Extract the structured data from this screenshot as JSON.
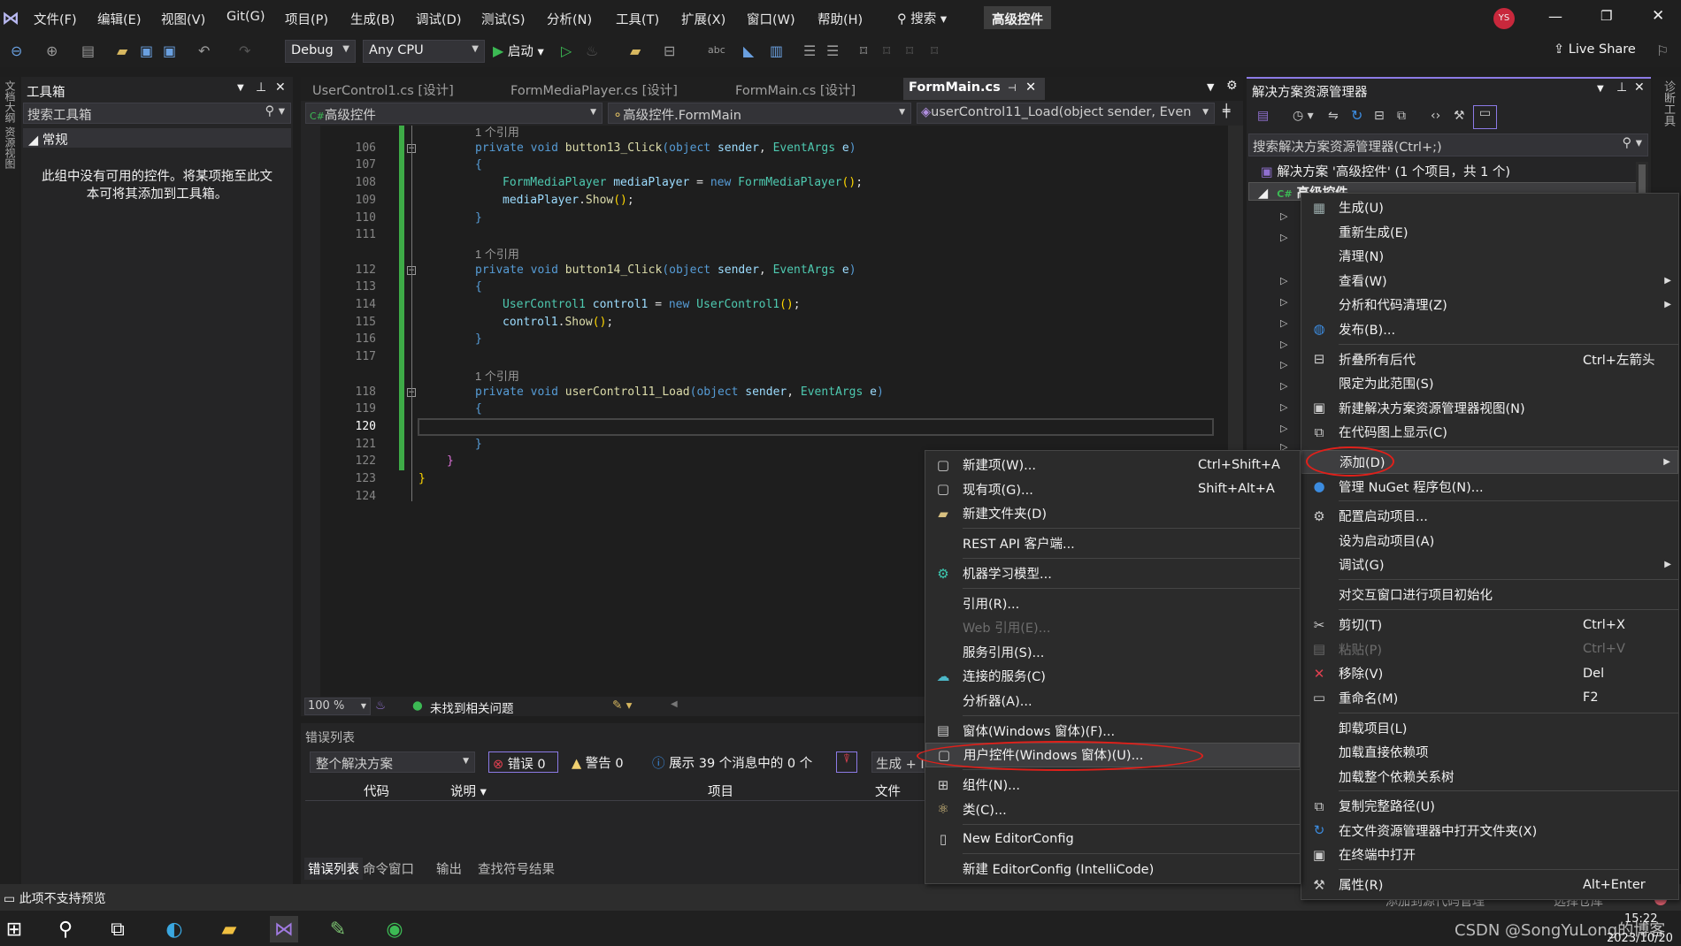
{
  "menubar": {
    "items": [
      "文件(F)",
      "编辑(E)",
      "视图(V)",
      "Git(G)",
      "项目(P)",
      "生成(B)",
      "调试(D)",
      "测试(S)",
      "分析(N)",
      "工具(T)",
      "扩展(X)",
      "窗口(W)",
      "帮助(H)"
    ],
    "search": "搜索",
    "solution_badge": "高级控件",
    "avatar": "YS"
  },
  "toolbar": {
    "config": "Debug",
    "platform": "Any CPU",
    "start": "启动",
    "live_share": "Live Share"
  },
  "toolbox": {
    "title": "工具箱",
    "search_placeholder": "搜索工具箱",
    "group": "常规",
    "empty_message_1": "此组中没有可用的控件。将某项拖至此文",
    "empty_message_2": "本可将其添加到工具箱。"
  },
  "left_strip": {
    "label": "文档大纲 资源视图"
  },
  "right_strip": {
    "label": "诊断工具"
  },
  "editor": {
    "tabs": [
      {
        "label": "UserControl1.cs [设计]",
        "active": false
      },
      {
        "label": "FormMediaPlayer.cs [设计]",
        "active": false
      },
      {
        "label": "FormMain.cs [设计]",
        "active": false
      },
      {
        "label": "FormMain.cs",
        "active": true
      }
    ],
    "nav": {
      "project": "高级控件",
      "class": "高级控件.FormMain",
      "member": "userControl11_Load(object sender, Even"
    },
    "lines": [
      {
        "lens": "1 个引用"
      },
      {
        "num": "106",
        "indent": 2,
        "tokens": [
          {
            "t": "private void ",
            "c": "kw"
          },
          {
            "t": "button13_Click",
            "c": "me"
          },
          {
            "t": "(",
            "c": "kw"
          },
          {
            "t": "object",
            "c": "kw"
          },
          {
            "t": " sender",
            "c": "id"
          },
          {
            "t": ", ",
            "c": "pl"
          },
          {
            "t": "EventArgs",
            "c": "ty"
          },
          {
            "t": " e",
            "c": "id"
          },
          {
            "t": ")",
            "c": "kw"
          }
        ]
      },
      {
        "num": "107",
        "indent": 2,
        "tokens": [
          {
            "t": "{",
            "c": "kw"
          }
        ]
      },
      {
        "num": "108",
        "indent": 3,
        "tokens": [
          {
            "t": "FormMediaPlayer",
            "c": "ty"
          },
          {
            "t": " mediaPlayer",
            "c": "id"
          },
          {
            "t": " = ",
            "c": "pl"
          },
          {
            "t": "new ",
            "c": "kw"
          },
          {
            "t": "FormMediaPlayer",
            "c": "ty"
          },
          {
            "t": "()",
            "c": "go"
          },
          {
            "t": ";",
            "c": "pl"
          }
        ]
      },
      {
        "num": "109",
        "indent": 3,
        "tokens": [
          {
            "t": "mediaPlayer",
            "c": "id"
          },
          {
            "t": ".",
            "c": "pl"
          },
          {
            "t": "Show",
            "c": "me"
          },
          {
            "t": "()",
            "c": "go"
          },
          {
            "t": ";",
            "c": "pl"
          }
        ]
      },
      {
        "num": "110",
        "indent": 2,
        "tokens": [
          {
            "t": "}",
            "c": "kw"
          }
        ]
      },
      {
        "num": "111",
        "indent": 2,
        "tokens": []
      },
      {
        "lens": "1 个引用"
      },
      {
        "num": "112",
        "indent": 2,
        "tokens": [
          {
            "t": "private void ",
            "c": "kw"
          },
          {
            "t": "button14_Click",
            "c": "me"
          },
          {
            "t": "(",
            "c": "kw"
          },
          {
            "t": "object",
            "c": "kw"
          },
          {
            "t": " sender",
            "c": "id"
          },
          {
            "t": ", ",
            "c": "pl"
          },
          {
            "t": "EventArgs",
            "c": "ty"
          },
          {
            "t": " e",
            "c": "id"
          },
          {
            "t": ")",
            "c": "kw"
          }
        ]
      },
      {
        "num": "113",
        "indent": 2,
        "tokens": [
          {
            "t": "{",
            "c": "kw"
          }
        ]
      },
      {
        "num": "114",
        "indent": 3,
        "tokens": [
          {
            "t": "UserControl1",
            "c": "ty"
          },
          {
            "t": " control1",
            "c": "id"
          },
          {
            "t": " = ",
            "c": "pl"
          },
          {
            "t": "new ",
            "c": "kw"
          },
          {
            "t": "UserControl1",
            "c": "ty"
          },
          {
            "t": "()",
            "c": "go"
          },
          {
            "t": ";",
            "c": "pl"
          }
        ]
      },
      {
        "num": "115",
        "indent": 3,
        "tokens": [
          {
            "t": "control1",
            "c": "id"
          },
          {
            "t": ".",
            "c": "pl"
          },
          {
            "t": "Show",
            "c": "me"
          },
          {
            "t": "()",
            "c": "go"
          },
          {
            "t": ";",
            "c": "pl"
          }
        ]
      },
      {
        "num": "116",
        "indent": 2,
        "tokens": [
          {
            "t": "}",
            "c": "kw"
          }
        ]
      },
      {
        "num": "117",
        "indent": 2,
        "tokens": []
      },
      {
        "lens": "1 个引用"
      },
      {
        "num": "118",
        "indent": 2,
        "tokens": [
          {
            "t": "private void ",
            "c": "kw"
          },
          {
            "t": "userControl11_Load",
            "c": "me"
          },
          {
            "t": "(",
            "c": "kw"
          },
          {
            "t": "object",
            "c": "kw"
          },
          {
            "t": " sender",
            "c": "id"
          },
          {
            "t": ", ",
            "c": "pl"
          },
          {
            "t": "EventArgs",
            "c": "ty"
          },
          {
            "t": " e",
            "c": "id"
          },
          {
            "t": ")",
            "c": "kw"
          }
        ]
      },
      {
        "num": "119",
        "indent": 2,
        "tokens": [
          {
            "t": "{",
            "c": "kw"
          }
        ]
      },
      {
        "num": "120",
        "indent": 2,
        "current": true,
        "tokens": []
      },
      {
        "num": "121",
        "indent": 2,
        "tokens": [
          {
            "t": "}",
            "c": "kw"
          }
        ]
      },
      {
        "num": "122",
        "indent": 1,
        "tokens": [
          {
            "t": "}",
            "c": "pk"
          }
        ]
      },
      {
        "num": "123",
        "indent": 0,
        "tokens": [
          {
            "t": "}",
            "c": "go"
          }
        ]
      },
      {
        "num": "124",
        "indent": 0,
        "tokens": []
      }
    ],
    "status": {
      "zoom": "100 %",
      "issues": "未找到相关问题"
    }
  },
  "error_list": {
    "title": "错误列表",
    "scope": "整个解决方案",
    "errors": "错误 0",
    "warnings": "警告 0",
    "messages": "展示 39 个消息中的 0 个",
    "build": "生成 + I",
    "columns": [
      "代码",
      "说明",
      "项目",
      "文件"
    ],
    "bottom_tabs": [
      "错误列表",
      "命令窗口",
      "输出",
      "查找符号结果"
    ]
  },
  "solution_explorer": {
    "title": "解决方案资源管理器",
    "search_placeholder": "搜索解决方案资源管理器(Ctrl+;)",
    "solution": "解决方案 '高级控件' (1 个项目，共 1 个)",
    "project": "高级控件"
  },
  "project_menu": [
    {
      "label": "生成(U)",
      "icon": "build-icon"
    },
    {
      "label": "重新生成(E)"
    },
    {
      "label": "清理(N)"
    },
    {
      "label": "查看(W)",
      "submenu": true
    },
    {
      "label": "分析和代码清理(Z)",
      "submenu": true
    },
    {
      "label": "发布(B)...",
      "icon": "publish-icon"
    },
    {
      "sep": true
    },
    {
      "label": "折叠所有后代",
      "shortcut": "Ctrl+左箭头",
      "icon": "collapse-icon"
    },
    {
      "label": "限定为此范围(S)"
    },
    {
      "label": "新建解决方案资源管理器视图(N)",
      "icon": "new-view-icon"
    },
    {
      "label": "在代码图上显示(C)",
      "icon": "code-map-icon"
    },
    {
      "sep": true
    },
    {
      "label": "添加(D)",
      "submenu": true,
      "highlighted": true
    },
    {
      "label": "管理 NuGet 程序包(N)...",
      "icon": "nuget-icon"
    },
    {
      "sep": true
    },
    {
      "label": "配置启动项目...",
      "icon": "settings-icon"
    },
    {
      "label": "设为启动项目(A)"
    },
    {
      "label": "调试(G)",
      "submenu": true
    },
    {
      "sep": true
    },
    {
      "label": "对交互窗口进行项目初始化"
    },
    {
      "sep": true
    },
    {
      "label": "剪切(T)",
      "shortcut": "Ctrl+X",
      "icon": "cut-icon"
    },
    {
      "label": "粘贴(P)",
      "shortcut": "Ctrl+V",
      "icon": "paste-icon",
      "disabled": true
    },
    {
      "label": "移除(V)",
      "shortcut": "Del",
      "icon": "remove-icon"
    },
    {
      "label": "重命名(M)",
      "shortcut": "F2",
      "icon": "rename-icon"
    },
    {
      "sep": true
    },
    {
      "label": "卸载项目(L)"
    },
    {
      "label": "加载直接依赖项"
    },
    {
      "label": "加载整个依赖关系树"
    },
    {
      "sep": true
    },
    {
      "label": "复制完整路径(U)",
      "icon": "copy-icon"
    },
    {
      "label": "在文件资源管理器中打开文件夹(X)",
      "icon": "open-folder-icon"
    },
    {
      "label": "在终端中打开",
      "icon": "terminal-icon"
    },
    {
      "sep": true
    },
    {
      "label": "属性(R)",
      "shortcut": "Alt+Enter",
      "icon": "wrench-icon"
    }
  ],
  "add_menu": [
    {
      "label": "新建项(W)...",
      "shortcut": "Ctrl+Shift+A",
      "icon": "new-item-icon"
    },
    {
      "label": "现有项(G)...",
      "shortcut": "Shift+Alt+A",
      "icon": "existing-item-icon"
    },
    {
      "label": "新建文件夹(D)",
      "icon": "new-folder-icon"
    },
    {
      "sep": true
    },
    {
      "label": "REST API 客户端..."
    },
    {
      "sep": true
    },
    {
      "label": "机器学习模型...",
      "icon": "ml-model-icon"
    },
    {
      "sep": true
    },
    {
      "label": "引用(R)..."
    },
    {
      "label": "Web 引用(E)...",
      "disabled": true
    },
    {
      "label": "服务引用(S)..."
    },
    {
      "label": "连接的服务(C)",
      "icon": "connected-service-icon"
    },
    {
      "label": "分析器(A)..."
    },
    {
      "sep": true
    },
    {
      "label": "窗体(Windows 窗体)(F)...",
      "icon": "form-icon"
    },
    {
      "label": "用户控件(Windows 窗体)(U)...",
      "icon": "user-control-icon",
      "highlighted": true
    },
    {
      "sep": true
    },
    {
      "label": "组件(N)...",
      "icon": "component-icon"
    },
    {
      "label": "类(C)...",
      "icon": "class-icon"
    },
    {
      "sep": true
    },
    {
      "label": "New EditorConfig",
      "icon": "file-icon"
    },
    {
      "sep": true
    },
    {
      "label": "新建 EditorConfig (IntelliCode)"
    }
  ],
  "statusbar": {
    "message": "此项不支持预览",
    "source_control": "添加到源代码管理 ^",
    "repo": "选择仓库 ^"
  },
  "taskbar": {
    "watermark": "CSDN @SongYuLong的博客",
    "time": "15:22",
    "date": "2023/10/20"
  },
  "colors": {
    "accent": "#8c7ae6",
    "annotation": "#e0201a",
    "highlight": "#3e3e40"
  }
}
